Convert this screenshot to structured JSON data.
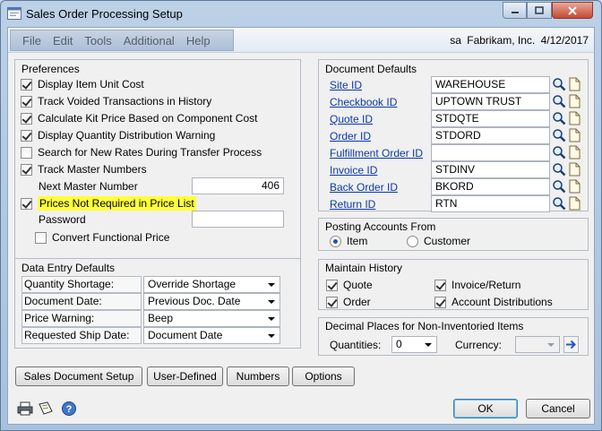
{
  "window": {
    "title": "Sales Order Processing Setup"
  },
  "menu": {
    "items": [
      "File",
      "Edit",
      "Tools",
      "Additional",
      "Help"
    ]
  },
  "status": {
    "user": "sa",
    "company": "Fabrikam, Inc.",
    "date": "4/12/2017"
  },
  "preferences": {
    "title": "Preferences",
    "items": [
      {
        "label": "Display Item Unit Cost",
        "checked": true
      },
      {
        "label": "Track Voided Transactions in History",
        "checked": true
      },
      {
        "label": "Calculate Kit Price Based on Component Cost",
        "checked": true
      },
      {
        "label": "Display Quantity Distribution Warning",
        "checked": true
      },
      {
        "label": "Search for New Rates During Transfer Process",
        "checked": false
      },
      {
        "label": "Track Master Numbers",
        "checked": true
      }
    ],
    "next_master_label": "Next Master Number",
    "next_master_value": "406",
    "prices_label": "Prices Not Required in Price List",
    "prices_checked": true,
    "password_label": "Password",
    "password_value": "",
    "convert_label": "Convert Functional Price",
    "convert_checked": false
  },
  "data_entry": {
    "title": "Data Entry Defaults",
    "rows": [
      {
        "label": "Quantity Shortage:",
        "value": "Override Shortage"
      },
      {
        "label": "Document Date:",
        "value": "Previous Doc. Date"
      },
      {
        "label": "Price Warning:",
        "value": "Beep"
      },
      {
        "label": "Requested Ship Date:",
        "value": "Document Date"
      }
    ]
  },
  "document_defaults": {
    "title": "Document Defaults",
    "rows": [
      {
        "label": "Site ID",
        "value": "WAREHOUSE"
      },
      {
        "label": "Checkbook ID",
        "value": "UPTOWN TRUST"
      },
      {
        "label": "Quote ID",
        "value": "STDQTE"
      },
      {
        "label": "Order ID",
        "value": "STDORD"
      },
      {
        "label": "Fulfillment Order ID",
        "value": ""
      },
      {
        "label": "Invoice ID",
        "value": "STDINV"
      },
      {
        "label": "Back Order ID",
        "value": "BKORD"
      },
      {
        "label": "Return ID",
        "value": "RTN"
      }
    ]
  },
  "posting": {
    "title": "Posting Accounts From",
    "options": [
      {
        "label": "Item",
        "selected": true
      },
      {
        "label": "Customer",
        "selected": false
      }
    ]
  },
  "history": {
    "title": "Maintain History",
    "items": [
      {
        "label": "Quote",
        "checked": true
      },
      {
        "label": "Invoice/Return",
        "checked": true
      },
      {
        "label": "Order",
        "checked": true
      },
      {
        "label": "Account Distributions",
        "checked": true
      }
    ]
  },
  "decimal": {
    "title": "Decimal Places for Non-Inventoried Items",
    "quantities_label": "Quantities:",
    "quantities_value": "0",
    "currency_label": "Currency:",
    "currency_value": ""
  },
  "buttons": {
    "sales_doc_setup": "Sales Document Setup",
    "user_defined": "User-Defined",
    "numbers": "Numbers",
    "options": "Options",
    "ok": "OK",
    "cancel": "Cancel"
  },
  "icons": {
    "print": "printer-icon",
    "note": "note-icon",
    "help": "help-icon",
    "lookup": "magnifier-icon",
    "new": "new-document-icon"
  },
  "colors": {
    "link": "#0b38a8",
    "highlight": "#ffff3a",
    "close_button": "#c34a34"
  }
}
